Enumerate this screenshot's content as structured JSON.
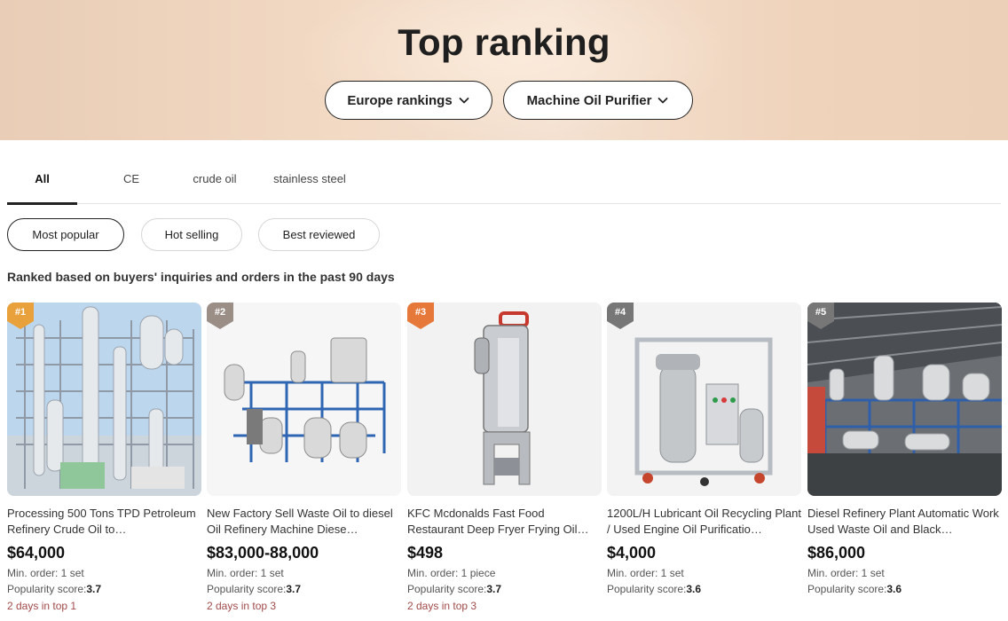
{
  "header": {
    "title": "Top ranking",
    "region_dropdown": "Europe rankings",
    "category_dropdown": "Machine Oil Purifier"
  },
  "tabs": [
    {
      "label": "All",
      "active": true
    },
    {
      "label": "CE",
      "active": false
    },
    {
      "label": "crude oil",
      "active": false
    },
    {
      "label": "stainless steel",
      "active": false
    }
  ],
  "filters": [
    {
      "label": "Most popular",
      "active": true
    },
    {
      "label": "Hot selling",
      "active": false
    },
    {
      "label": "Best reviewed",
      "active": false
    }
  ],
  "ranking_note": "Ranked based on buyers' inquiries and orders in the past 90 days",
  "products": [
    {
      "rank": "#1",
      "rank_color": "#e9a13b",
      "title": "Processing 500 Tons TPD Petroleum Refinery Crude Oil to…",
      "price": "$64,000",
      "moq": "Min. order: 1 set",
      "popularity_label": "Popularity score:",
      "popularity_value": "3.7",
      "days": "2 days in top 1"
    },
    {
      "rank": "#2",
      "rank_color": "#9b8e86",
      "title": "New Factory Sell Waste Oil to diesel Oil Refinery Machine Diese…",
      "price": "$83,000-88,000",
      "moq": "Min. order: 1 set",
      "popularity_label": "Popularity score:",
      "popularity_value": "3.7",
      "days": "2 days in top 3"
    },
    {
      "rank": "#3",
      "rank_color": "#e6793a",
      "title": "KFC Mcdonalds Fast Food Restaurant Deep Fryer Frying Oil…",
      "price": "$498",
      "moq": "Min. order: 1 piece",
      "popularity_label": "Popularity score:",
      "popularity_value": "3.7",
      "days": "2 days in top 3"
    },
    {
      "rank": "#4",
      "rank_color": "#777777",
      "title": "1200L/H Lubricant Oil Recycling Plant / Used Engine Oil Purificatio…",
      "price": "$4,000",
      "moq": "Min. order: 1 set",
      "popularity_label": "Popularity score:",
      "popularity_value": "3.6",
      "days": ""
    },
    {
      "rank": "#5",
      "rank_color": "#777777",
      "title": "Diesel Refinery Plant Automatic Work Used Waste Oil and Black…",
      "price": "$86,000",
      "moq": "Min. order: 1 set",
      "popularity_label": "Popularity score:",
      "popularity_value": "3.6",
      "days": ""
    }
  ],
  "icons": {
    "dropdown": "chevron-down-icon"
  }
}
